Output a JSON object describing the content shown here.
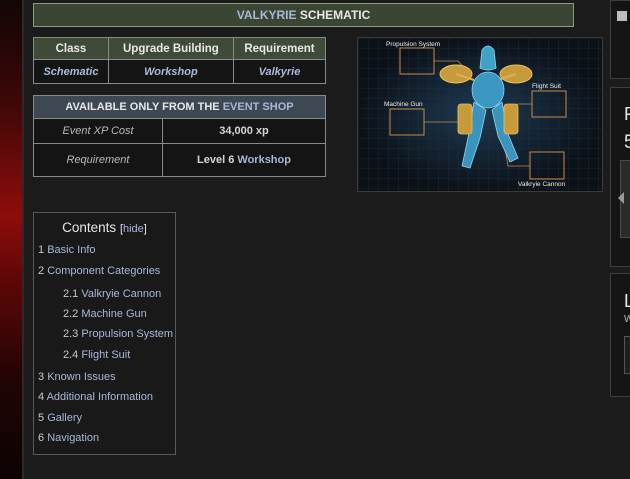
{
  "title": {
    "prefix": "VALKYRIE",
    "suffix": "SCHEMATIC"
  },
  "info_table": {
    "headers": [
      "Class",
      "Upgrade Building",
      "Requirement"
    ],
    "values": [
      "Schematic",
      "Workshop",
      "Valkyrie"
    ]
  },
  "event_table": {
    "header_prefix": "AVAILABLE ONLY FROM THE",
    "header_link": "EVENT SHOP",
    "xp_label": "Event XP Cost",
    "xp_value": "34,000 xp",
    "req_label": "Requirement",
    "req_prefix": "Level 6",
    "req_link": "Workshop"
  },
  "schematic": {
    "labels": [
      "Propulsion System",
      "Flight Suit",
      "Machine Gun",
      "Valkryie Cannon"
    ]
  },
  "toc": {
    "title": "Contents",
    "hide_label": "hide",
    "items": [
      {
        "num": "1",
        "text": "Basic Info"
      },
      {
        "num": "2",
        "text": "Component Categories"
      },
      {
        "num": "2.1",
        "text": "Valkryie Cannon"
      },
      {
        "num": "2.2",
        "text": "Machine Gun"
      },
      {
        "num": "2.3",
        "text": "Propulsion System"
      },
      {
        "num": "2.4",
        "text": "Flight Suit"
      },
      {
        "num": "3",
        "text": "Known Issues"
      },
      {
        "num": "4",
        "text": "Additional Information"
      },
      {
        "num": "5",
        "text": "Gallery"
      },
      {
        "num": "6",
        "text": "Navigation"
      }
    ]
  },
  "right_panels": {
    "p2_char": "F",
    "p2_num": "5",
    "p3_char": "L",
    "p3_sub": "W"
  }
}
